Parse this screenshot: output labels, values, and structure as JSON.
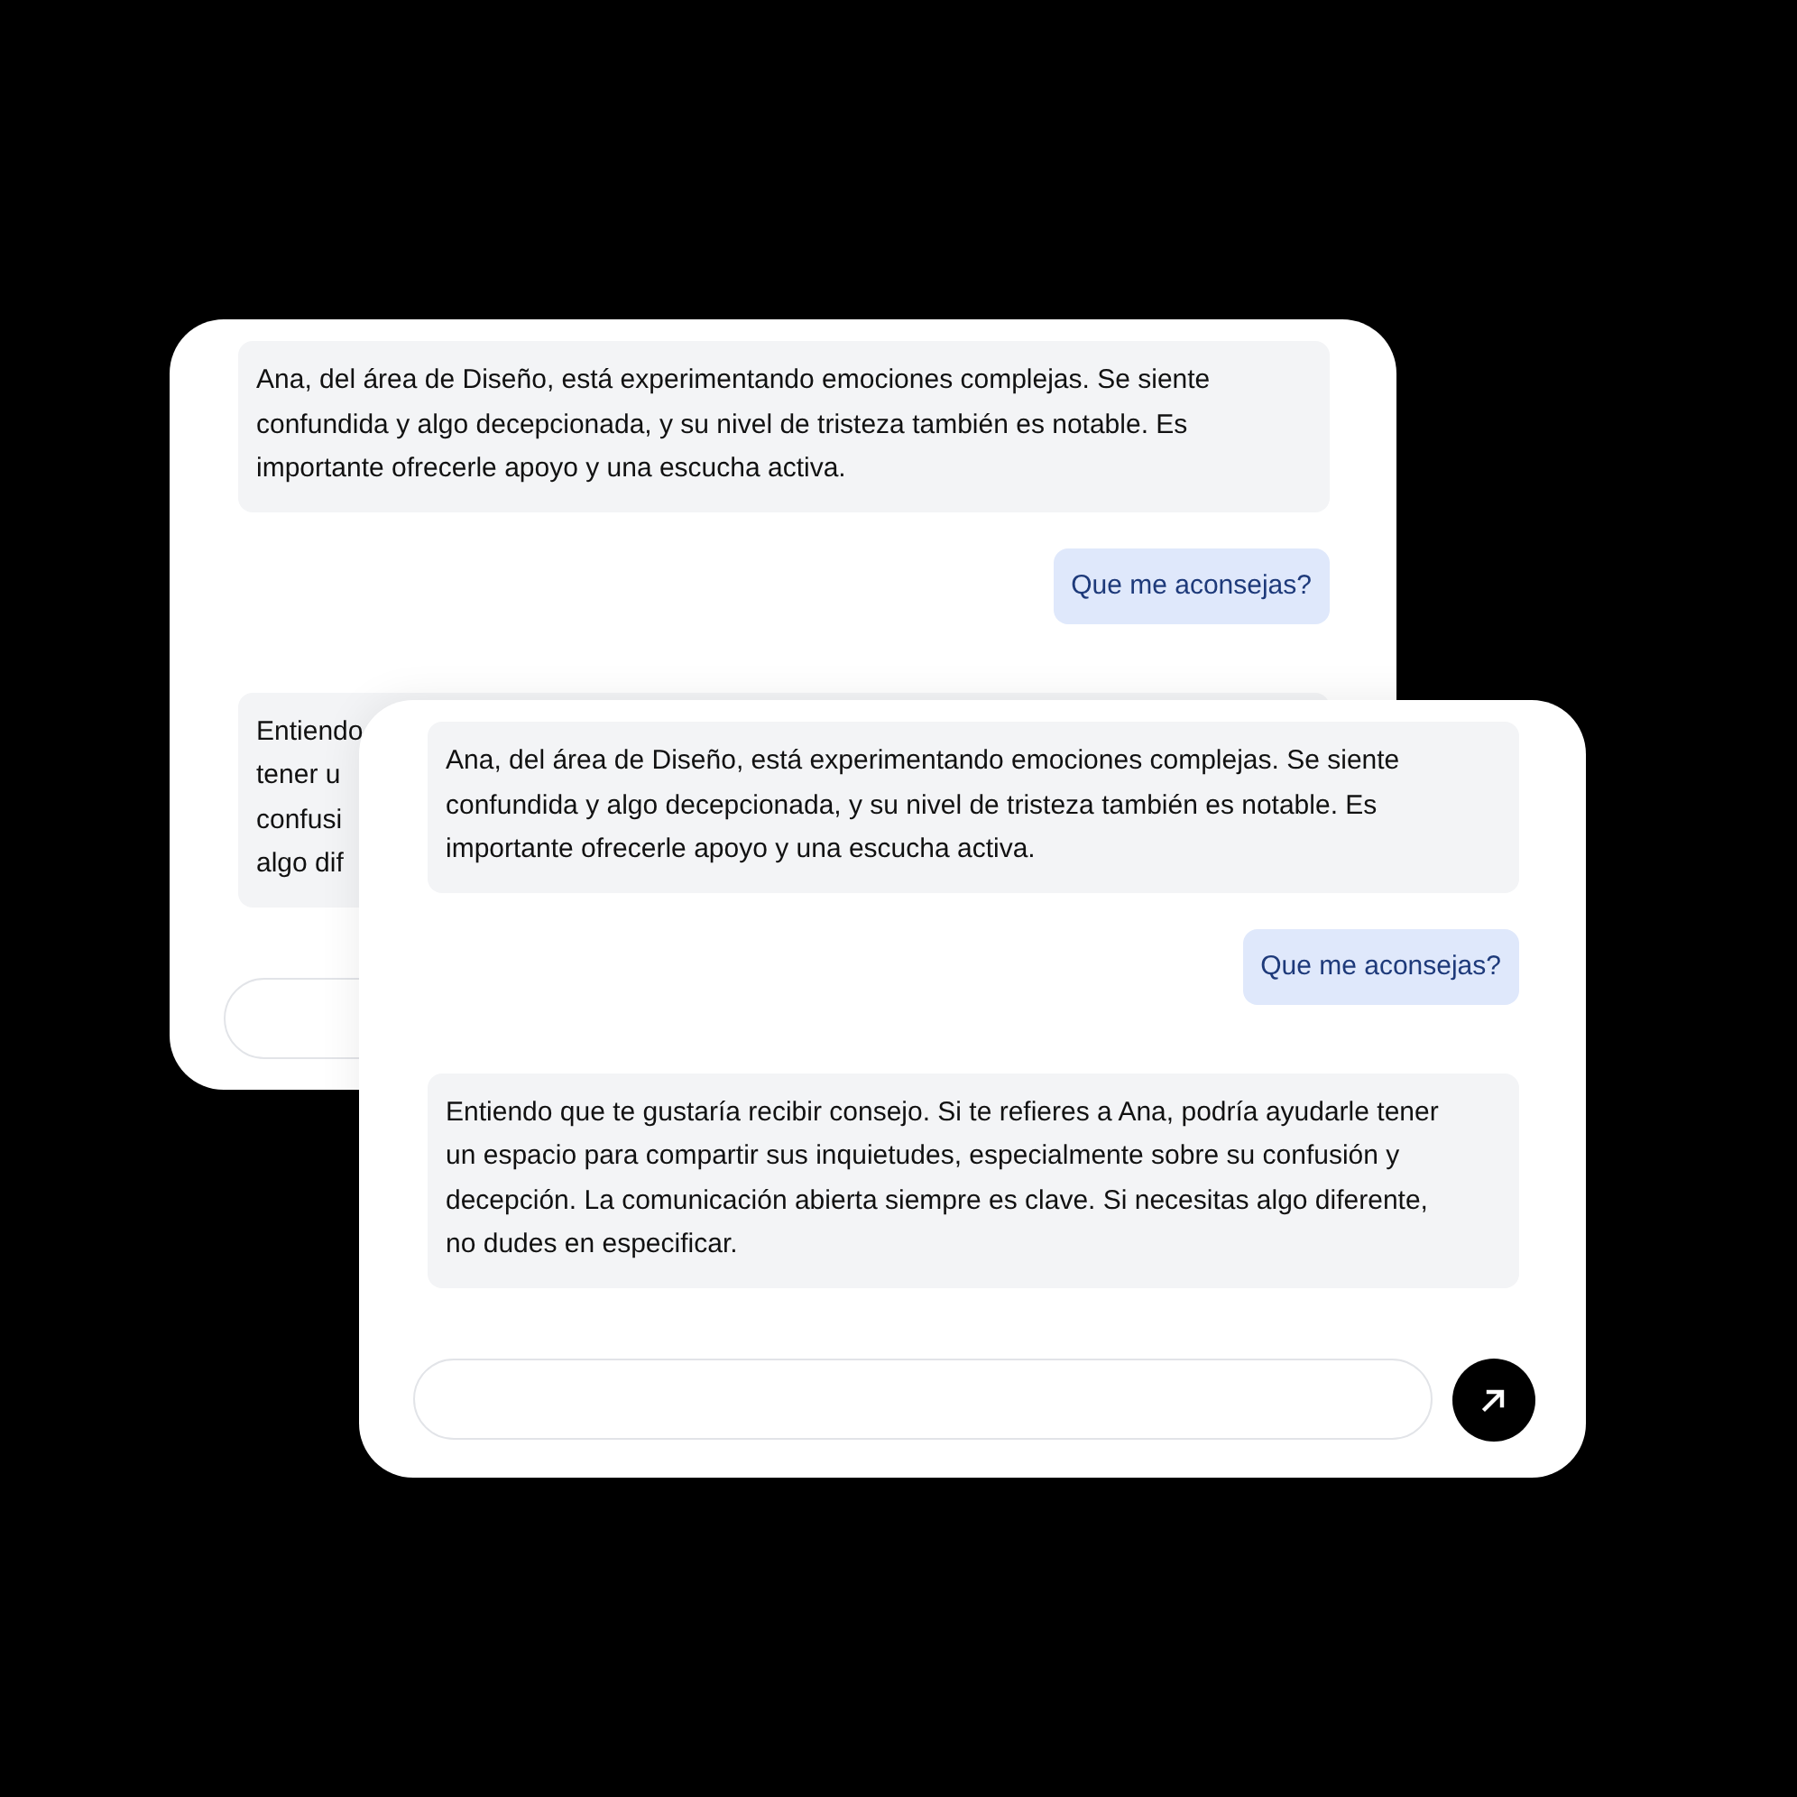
{
  "cards": [
    {
      "messages": [
        {
          "kind": "assistant",
          "text": "Ana, del área de Diseño, está experimentando emociones complejas. Se siente confundida y algo decepcionada, y su nivel de tristeza también es notable. Es importante ofrecerle apoyo y una escucha activa."
        },
        {
          "kind": "user",
          "text": "Que me aconsejas?"
        },
        {
          "kind": "assistant",
          "lines": [
            "Entiendo",
            "tener u",
            "confusi",
            "algo dif"
          ]
        }
      ],
      "send_button": false
    },
    {
      "messages": [
        {
          "kind": "assistant",
          "text": "Ana, del área de Diseño, está experimentando emociones complejas. Se siente confundida y algo decepcionada, y su nivel de tristeza también es notable. Es importante ofrecerle apoyo y una escucha activa."
        },
        {
          "kind": "user",
          "text": "Que me aconsejas?"
        },
        {
          "kind": "assistant",
          "text": "Entiendo que te gustaría recibir consejo. Si te refieres a Ana, podría ayudarle tener un espacio para compartir sus inquietudes, especialmente sobre su confusión y decepción. La comunicación abierta siempre es clave. Si necesitas algo diferente, no dudes en especificar."
        }
      ],
      "send_button": true
    }
  ]
}
